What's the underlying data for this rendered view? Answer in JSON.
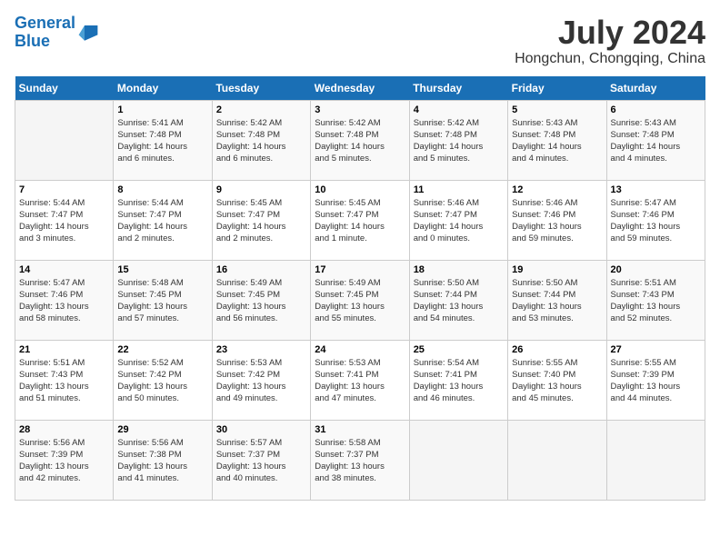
{
  "header": {
    "logo_line1": "General",
    "logo_line2": "Blue",
    "month_year": "July 2024",
    "location": "Hongchun, Chongqing, China"
  },
  "days_of_week": [
    "Sunday",
    "Monday",
    "Tuesday",
    "Wednesday",
    "Thursday",
    "Friday",
    "Saturday"
  ],
  "weeks": [
    [
      {
        "day": "",
        "info": ""
      },
      {
        "day": "1",
        "info": "Sunrise: 5:41 AM\nSunset: 7:48 PM\nDaylight: 14 hours\nand 6 minutes."
      },
      {
        "day": "2",
        "info": "Sunrise: 5:42 AM\nSunset: 7:48 PM\nDaylight: 14 hours\nand 6 minutes."
      },
      {
        "day": "3",
        "info": "Sunrise: 5:42 AM\nSunset: 7:48 PM\nDaylight: 14 hours\nand 5 minutes."
      },
      {
        "day": "4",
        "info": "Sunrise: 5:42 AM\nSunset: 7:48 PM\nDaylight: 14 hours\nand 5 minutes."
      },
      {
        "day": "5",
        "info": "Sunrise: 5:43 AM\nSunset: 7:48 PM\nDaylight: 14 hours\nand 4 minutes."
      },
      {
        "day": "6",
        "info": "Sunrise: 5:43 AM\nSunset: 7:48 PM\nDaylight: 14 hours\nand 4 minutes."
      }
    ],
    [
      {
        "day": "7",
        "info": "Sunrise: 5:44 AM\nSunset: 7:47 PM\nDaylight: 14 hours\nand 3 minutes."
      },
      {
        "day": "8",
        "info": "Sunrise: 5:44 AM\nSunset: 7:47 PM\nDaylight: 14 hours\nand 2 minutes."
      },
      {
        "day": "9",
        "info": "Sunrise: 5:45 AM\nSunset: 7:47 PM\nDaylight: 14 hours\nand 2 minutes."
      },
      {
        "day": "10",
        "info": "Sunrise: 5:45 AM\nSunset: 7:47 PM\nDaylight: 14 hours\nand 1 minute."
      },
      {
        "day": "11",
        "info": "Sunrise: 5:46 AM\nSunset: 7:47 PM\nDaylight: 14 hours\nand 0 minutes."
      },
      {
        "day": "12",
        "info": "Sunrise: 5:46 AM\nSunset: 7:46 PM\nDaylight: 13 hours\nand 59 minutes."
      },
      {
        "day": "13",
        "info": "Sunrise: 5:47 AM\nSunset: 7:46 PM\nDaylight: 13 hours\nand 59 minutes."
      }
    ],
    [
      {
        "day": "14",
        "info": "Sunrise: 5:47 AM\nSunset: 7:46 PM\nDaylight: 13 hours\nand 58 minutes."
      },
      {
        "day": "15",
        "info": "Sunrise: 5:48 AM\nSunset: 7:45 PM\nDaylight: 13 hours\nand 57 minutes."
      },
      {
        "day": "16",
        "info": "Sunrise: 5:49 AM\nSunset: 7:45 PM\nDaylight: 13 hours\nand 56 minutes."
      },
      {
        "day": "17",
        "info": "Sunrise: 5:49 AM\nSunset: 7:45 PM\nDaylight: 13 hours\nand 55 minutes."
      },
      {
        "day": "18",
        "info": "Sunrise: 5:50 AM\nSunset: 7:44 PM\nDaylight: 13 hours\nand 54 minutes."
      },
      {
        "day": "19",
        "info": "Sunrise: 5:50 AM\nSunset: 7:44 PM\nDaylight: 13 hours\nand 53 minutes."
      },
      {
        "day": "20",
        "info": "Sunrise: 5:51 AM\nSunset: 7:43 PM\nDaylight: 13 hours\nand 52 minutes."
      }
    ],
    [
      {
        "day": "21",
        "info": "Sunrise: 5:51 AM\nSunset: 7:43 PM\nDaylight: 13 hours\nand 51 minutes."
      },
      {
        "day": "22",
        "info": "Sunrise: 5:52 AM\nSunset: 7:42 PM\nDaylight: 13 hours\nand 50 minutes."
      },
      {
        "day": "23",
        "info": "Sunrise: 5:53 AM\nSunset: 7:42 PM\nDaylight: 13 hours\nand 49 minutes."
      },
      {
        "day": "24",
        "info": "Sunrise: 5:53 AM\nSunset: 7:41 PM\nDaylight: 13 hours\nand 47 minutes."
      },
      {
        "day": "25",
        "info": "Sunrise: 5:54 AM\nSunset: 7:41 PM\nDaylight: 13 hours\nand 46 minutes."
      },
      {
        "day": "26",
        "info": "Sunrise: 5:55 AM\nSunset: 7:40 PM\nDaylight: 13 hours\nand 45 minutes."
      },
      {
        "day": "27",
        "info": "Sunrise: 5:55 AM\nSunset: 7:39 PM\nDaylight: 13 hours\nand 44 minutes."
      }
    ],
    [
      {
        "day": "28",
        "info": "Sunrise: 5:56 AM\nSunset: 7:39 PM\nDaylight: 13 hours\nand 42 minutes."
      },
      {
        "day": "29",
        "info": "Sunrise: 5:56 AM\nSunset: 7:38 PM\nDaylight: 13 hours\nand 41 minutes."
      },
      {
        "day": "30",
        "info": "Sunrise: 5:57 AM\nSunset: 7:37 PM\nDaylight: 13 hours\nand 40 minutes."
      },
      {
        "day": "31",
        "info": "Sunrise: 5:58 AM\nSunset: 7:37 PM\nDaylight: 13 hours\nand 38 minutes."
      },
      {
        "day": "",
        "info": ""
      },
      {
        "day": "",
        "info": ""
      },
      {
        "day": "",
        "info": ""
      }
    ]
  ]
}
